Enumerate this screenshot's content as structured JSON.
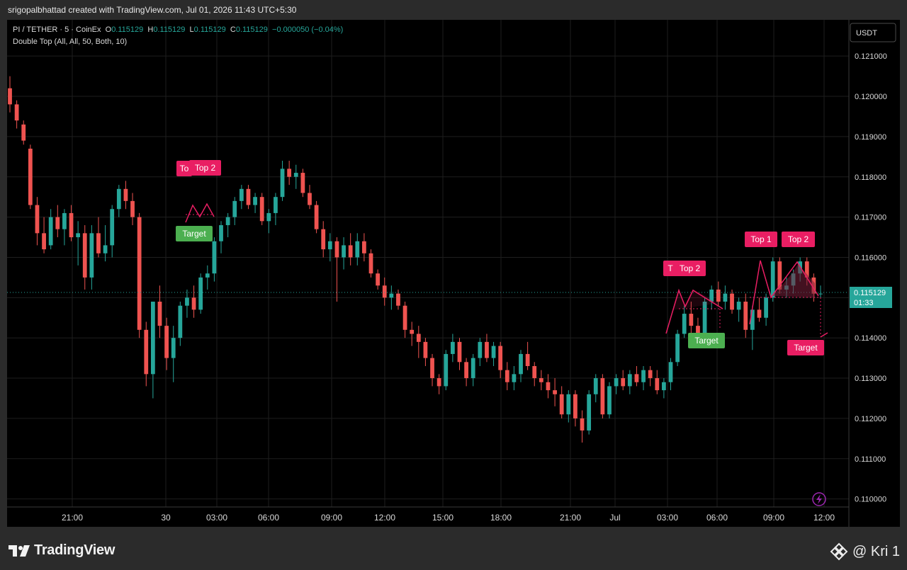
{
  "header": {
    "attribution": "srigopalbhattad created with TradingView.com, Jul 01, 2026 11:43 UTC+5:30"
  },
  "legend": {
    "symbol": "PI / TETHER · 5 · CoinEx",
    "o_label": "O",
    "o": "0.115129",
    "h_label": "H",
    "h": "0.115129",
    "l_label": "L",
    "l": "0.115129",
    "c_label": "C",
    "c": "0.115129",
    "change": "−0.000050 (−0.04%)",
    "indicator": "Double Top (All, All, 50, Both, 10)"
  },
  "currency_button": "USDT",
  "last_price": {
    "value": "0.115129",
    "countdown": "01:33"
  },
  "footer": {
    "brand": "TradingView",
    "credit": "@ Kri 1"
  },
  "colors": {
    "up": "#26a69a",
    "down": "#ef5350",
    "pattern": "#e91e63",
    "target_green": "#4caf50",
    "background": "#000000"
  },
  "chart_data": {
    "type": "candlestick",
    "ylim": [
      0.1098,
      0.1219
    ],
    "y_ticks": [
      "0.121000",
      "0.120000",
      "0.119000",
      "0.118000",
      "0.117000",
      "0.116000",
      "0.115000",
      "0.114000",
      "0.113000",
      "0.112000",
      "0.111000",
      "0.110000"
    ],
    "x_ticks": [
      "21:00",
      "30",
      "03:00",
      "06:00",
      "09:00",
      "12:00",
      "15:00",
      "18:00",
      "21:00",
      "Jul",
      "03:00",
      "06:00",
      "09:00",
      "12:00"
    ],
    "series": [
      {
        "values": [
          [
            0.1202,
            0.1205,
            0.1196,
            0.1198
          ],
          [
            0.1198,
            0.1199,
            0.1192,
            0.1194
          ],
          [
            0.1193,
            0.1194,
            0.1188,
            0.1189
          ],
          [
            0.1187,
            0.1188,
            0.1172,
            0.1173
          ],
          [
            0.1173,
            0.1175,
            0.1163,
            0.1166
          ],
          [
            0.1166,
            0.117,
            0.1161,
            0.1162
          ],
          [
            0.1163,
            0.1172,
            0.1162,
            0.117
          ],
          [
            0.117,
            0.1173,
            0.1165,
            0.1167
          ],
          [
            0.1167,
            0.1172,
            0.1163,
            0.1171
          ],
          [
            0.1171,
            0.1173,
            0.1164,
            0.1165
          ],
          [
            0.1165,
            0.1169,
            0.1158,
            0.1166
          ],
          [
            0.1166,
            0.1168,
            0.1152,
            0.1155
          ],
          [
            0.1155,
            0.1168,
            0.1152,
            0.1166
          ],
          [
            0.1166,
            0.117,
            0.116,
            0.1161
          ],
          [
            0.1161,
            0.1168,
            0.1159,
            0.1163
          ],
          [
            0.1163,
            0.1173,
            0.116,
            0.1172
          ],
          [
            0.1172,
            0.1178,
            0.117,
            0.1177
          ],
          [
            0.1177,
            0.1179,
            0.1172,
            0.1174
          ],
          [
            0.1174,
            0.1176,
            0.1168,
            0.117
          ],
          [
            0.117,
            0.1171,
            0.114,
            0.1142
          ],
          [
            0.1142,
            0.1144,
            0.1128,
            0.1131
          ],
          [
            0.1131,
            0.1149,
            0.1125,
            0.1149
          ],
          [
            0.1149,
            0.1153,
            0.114,
            0.1143
          ],
          [
            0.1143,
            0.1145,
            0.1132,
            0.1135
          ],
          [
            0.1135,
            0.1143,
            0.1129,
            0.114
          ],
          [
            0.114,
            0.1149,
            0.1138,
            0.1148
          ],
          [
            0.1148,
            0.1152,
            0.1145,
            0.115
          ],
          [
            0.115,
            0.1153,
            0.1145,
            0.1147
          ],
          [
            0.1147,
            0.1156,
            0.1146,
            0.1155
          ],
          [
            0.1155,
            0.1158,
            0.1152,
            0.1156
          ],
          [
            0.1156,
            0.1165,
            0.1154,
            0.1164
          ],
          [
            0.1164,
            0.1169,
            0.1161,
            0.1168
          ],
          [
            0.1168,
            0.1171,
            0.1165,
            0.117
          ],
          [
            0.117,
            0.1175,
            0.1168,
            0.1174
          ],
          [
            0.1174,
            0.1178,
            0.1172,
            0.1177
          ],
          [
            0.1177,
            0.1178,
            0.1172,
            0.1173
          ],
          [
            0.1173,
            0.1176,
            0.1171,
            0.1175
          ],
          [
            0.1175,
            0.1176,
            0.1168,
            0.1169
          ],
          [
            0.1169,
            0.1172,
            0.1166,
            0.1171
          ],
          [
            0.1171,
            0.1176,
            0.1168,
            0.1175
          ],
          [
            0.1175,
            0.1184,
            0.1174,
            0.1182
          ],
          [
            0.1182,
            0.1184,
            0.1178,
            0.118
          ],
          [
            0.118,
            0.1183,
            0.1177,
            0.1181
          ],
          [
            0.1181,
            0.1182,
            0.1175,
            0.1176
          ],
          [
            0.1176,
            0.1178,
            0.1172,
            0.1173
          ],
          [
            0.1173,
            0.1174,
            0.1166,
            0.1167
          ],
          [
            0.1167,
            0.1169,
            0.116,
            0.1162
          ],
          [
            0.1162,
            0.1166,
            0.1159,
            0.1164
          ],
          [
            0.1164,
            0.1165,
            0.1149,
            0.116
          ],
          [
            0.116,
            0.1165,
            0.1157,
            0.1163
          ],
          [
            0.1163,
            0.1166,
            0.1158,
            0.116
          ],
          [
            0.116,
            0.1166,
            0.1158,
            0.1164
          ],
          [
            0.1164,
            0.1166,
            0.1159,
            0.1161
          ],
          [
            0.1161,
            0.1162,
            0.1155,
            0.1156
          ],
          [
            0.1156,
            0.1157,
            0.1152,
            0.1153
          ],
          [
            0.1153,
            0.1155,
            0.1148,
            0.115
          ],
          [
            0.115,
            0.1153,
            0.1147,
            0.1151
          ],
          [
            0.1151,
            0.1152,
            0.1147,
            0.1148
          ],
          [
            0.1148,
            0.1149,
            0.114,
            0.1142
          ],
          [
            0.1142,
            0.1144,
            0.1138,
            0.1141
          ],
          [
            0.1141,
            0.1143,
            0.1135,
            0.1139
          ],
          [
            0.1139,
            0.114,
            0.1133,
            0.1135
          ],
          [
            0.1135,
            0.1136,
            0.1128,
            0.113
          ],
          [
            0.113,
            0.1131,
            0.1126,
            0.1128
          ],
          [
            0.1128,
            0.1137,
            0.1127,
            0.1136
          ],
          [
            0.1136,
            0.1141,
            0.1134,
            0.1139
          ],
          [
            0.1139,
            0.114,
            0.1132,
            0.1134
          ],
          [
            0.1134,
            0.1135,
            0.1128,
            0.113
          ],
          [
            0.113,
            0.1136,
            0.1128,
            0.1135
          ],
          [
            0.1135,
            0.114,
            0.1133,
            0.1139
          ],
          [
            0.1139,
            0.1141,
            0.1134,
            0.1135
          ],
          [
            0.1135,
            0.1139,
            0.1133,
            0.1138
          ],
          [
            0.1138,
            0.1139,
            0.113,
            0.1132
          ],
          [
            0.1132,
            0.1134,
            0.1127,
            0.1129
          ],
          [
            0.1129,
            0.1133,
            0.1127,
            0.1131
          ],
          [
            0.1131,
            0.1137,
            0.1129,
            0.1136
          ],
          [
            0.1136,
            0.1139,
            0.1132,
            0.1133
          ],
          [
            0.1133,
            0.1134,
            0.1128,
            0.113
          ],
          [
            0.113,
            0.1132,
            0.1127,
            0.1129
          ],
          [
            0.1129,
            0.1131,
            0.1125,
            0.1127
          ],
          [
            0.1127,
            0.113,
            0.1123,
            0.1126
          ],
          [
            0.1126,
            0.1128,
            0.112,
            0.1121
          ],
          [
            0.1121,
            0.1127,
            0.1119,
            0.1126
          ],
          [
            0.1126,
            0.1127,
            0.1118,
            0.112
          ],
          [
            0.112,
            0.1122,
            0.1114,
            0.1117
          ],
          [
            0.1117,
            0.1127,
            0.1116,
            0.1126
          ],
          [
            0.1126,
            0.1131,
            0.1124,
            0.113
          ],
          [
            0.113,
            0.1131,
            0.112,
            0.1121
          ],
          [
            0.1121,
            0.1129,
            0.112,
            0.1128
          ],
          [
            0.1128,
            0.1131,
            0.1126,
            0.113
          ],
          [
            0.113,
            0.1132,
            0.1127,
            0.1128
          ],
          [
            0.1128,
            0.1132,
            0.1126,
            0.1131
          ],
          [
            0.1131,
            0.1133,
            0.1128,
            0.1129
          ],
          [
            0.1129,
            0.1133,
            0.1127,
            0.1132
          ],
          [
            0.1132,
            0.1133,
            0.1128,
            0.113
          ],
          [
            0.113,
            0.1132,
            0.1126,
            0.1127
          ],
          [
            0.1127,
            0.113,
            0.1125,
            0.1129
          ],
          [
            0.1129,
            0.1135,
            0.1127,
            0.1134
          ],
          [
            0.1134,
            0.1142,
            0.1133,
            0.1141
          ],
          [
            0.1141,
            0.1148,
            0.114,
            0.1146
          ],
          [
            0.1146,
            0.1149,
            0.1141,
            0.1143
          ],
          [
            0.1143,
            0.1145,
            0.114,
            0.1141
          ],
          [
            0.1141,
            0.115,
            0.114,
            0.1149
          ],
          [
            0.1149,
            0.1153,
            0.1147,
            0.1152
          ],
          [
            0.1152,
            0.1154,
            0.1148,
            0.1149
          ],
          [
            0.1149,
            0.1153,
            0.1147,
            0.1151
          ],
          [
            0.1151,
            0.1152,
            0.1146,
            0.1147
          ],
          [
            0.1147,
            0.115,
            0.1144,
            0.1149
          ],
          [
            0.1149,
            0.1151,
            0.114,
            0.1142
          ],
          [
            0.1142,
            0.1148,
            0.1137,
            0.1147
          ],
          [
            0.1147,
            0.115,
            0.1144,
            0.1145
          ],
          [
            0.1145,
            0.1151,
            0.1143,
            0.115
          ],
          [
            0.115,
            0.116,
            0.1149,
            0.1159
          ],
          [
            0.1159,
            0.116,
            0.1151,
            0.1152
          ],
          [
            0.1152,
            0.1155,
            0.115,
            0.1153
          ],
          [
            0.1153,
            0.1157,
            0.1151,
            0.1156
          ],
          [
            0.1156,
            0.116,
            0.1154,
            0.1159
          ],
          [
            0.1159,
            0.116,
            0.1153,
            0.1155
          ],
          [
            0.1155,
            0.1156,
            0.1149,
            0.1151
          ],
          [
            0.1151,
            0.1153,
            0.115,
            0.1151
          ]
        ]
      }
    ],
    "annotations": {
      "pattern_1": {
        "labels": [
          "Top 1",
          "Top 2"
        ],
        "target_label": "Target",
        "target_color": "green"
      },
      "pattern_2": {
        "labels": [
          "Top 1",
          "Top 2"
        ],
        "target_label": "Target",
        "target_color": "green"
      },
      "pattern_3": {
        "labels": [
          "Top 1",
          "Top 2"
        ],
        "target_label": "Target",
        "target_color": "red"
      }
    }
  }
}
